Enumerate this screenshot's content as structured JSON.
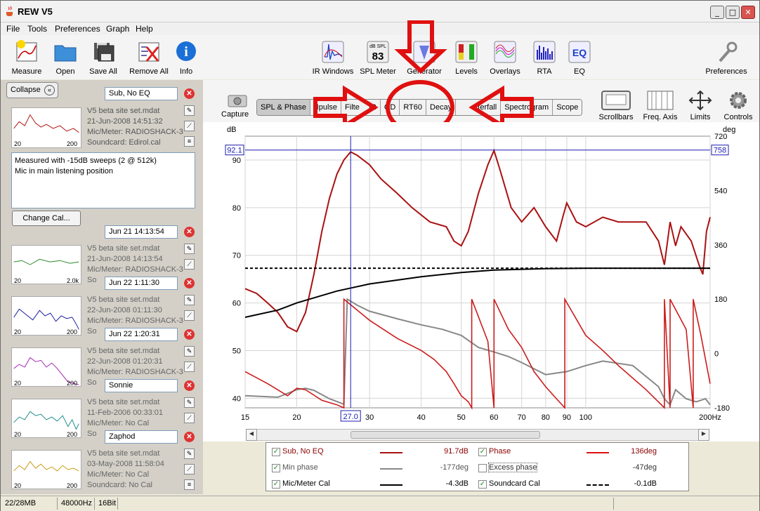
{
  "app": {
    "title": "REW V5"
  },
  "menu": [
    "File",
    "Tools",
    "Preferences",
    "Graph",
    "Help"
  ],
  "toolbar": [
    {
      "label": "Measure",
      "icon": "measure-icon"
    },
    {
      "label": "Open",
      "icon": "folder-icon"
    },
    {
      "label": "Save All",
      "icon": "floppy-icon"
    },
    {
      "label": "Remove All",
      "icon": "remove-all-icon"
    },
    {
      "label": "Info",
      "icon": "info-icon"
    },
    {
      "label": "IR Windows",
      "icon": "ir-windows-icon"
    },
    {
      "label": "SPL Meter",
      "icon": "spl-meter-icon",
      "badge_top": "dB SPL",
      "badge_value": "83"
    },
    {
      "label": "Generator",
      "icon": "generator-icon"
    },
    {
      "label": "Levels",
      "icon": "levels-icon"
    },
    {
      "label": "Overlays",
      "icon": "overlays-icon"
    },
    {
      "label": "RTA",
      "icon": "rta-icon"
    },
    {
      "label": "EQ",
      "icon": "eq-icon"
    },
    {
      "label": "Preferences",
      "icon": "wrench-icon"
    }
  ],
  "left_panel": {
    "collapse_label": "Collapse",
    "change_cal_label": "Change Cal...",
    "notes": [
      "Measured with -15dB sweeps (2 @ 512k)",
      "Mic in main listening position"
    ],
    "measurements": [
      {
        "num": "1",
        "name": "Sub, No EQ",
        "file": "V5 beta site set.mdat",
        "date": "21-Jun-2008 14:51:32",
        "mic": "Mic/Meter: RADIOSHACK-3",
        "card": "Soundcard: Edirol.cal",
        "axis_left": "20",
        "axis_right": "200",
        "color": "#b01010"
      },
      {
        "num": "2",
        "name": "Jun 21 14:13:54",
        "file": "V5 beta site set.mdat",
        "date": "21-Jun-2008 14:13:54",
        "mic": "Mic/Meter: RADIOSHACK-3",
        "card": "So",
        "axis_left": "20",
        "axis_right": "2.0k",
        "color": "#2a8a2a"
      },
      {
        "num": "3",
        "name": "Jun 22 1:11:30",
        "file": "V5 beta site set.mdat",
        "date": "22-Jun-2008 01:11:30",
        "mic": "Mic/Meter: RADIOSHACK-3",
        "card": "So",
        "axis_left": "20",
        "axis_right": "200",
        "color": "#1a1aa0"
      },
      {
        "num": "4",
        "name": "Jun 22 1:20:31",
        "file": "V5 beta site set.mdat",
        "date": "22-Jun-2008 01:20:31",
        "mic": "Mic/Meter: RADIOSHACK-3",
        "card": "So",
        "axis_left": "20",
        "axis_right": "200",
        "color": "#a020b0"
      },
      {
        "num": "5",
        "name": "Sonnie",
        "file": "V5 beta site set.mdat",
        "date": "11-Feb-2006 00:33:01",
        "mic": "Mic/Meter: No Cal",
        "card": "So",
        "axis_left": "20",
        "axis_right": "200",
        "color": "#1a8a8a"
      },
      {
        "num": "6",
        "name": "Zaphod",
        "file": "V5 beta site set.mdat",
        "date": "03-May-2008 11:58:04",
        "mic": "Mic/Meter: No Cal",
        "card": "Soundcard: No Cal",
        "axis_left": "20",
        "axis_right": "200",
        "color": "#c89a10"
      }
    ]
  },
  "graph_tools": {
    "capture": "Capture",
    "tabs": [
      "SPL & Phase",
      "Impulse",
      "Filtered IR",
      "GD",
      "RT60",
      "Decay",
      "Waterfall",
      "Spectrogram",
      "Scope"
    ],
    "tabs_visible": [
      "SPL & Phase",
      "Ipulse",
      "Filte",
      "IR",
      "GD",
      "RT60",
      "Decay",
      "terfall",
      "Spectrogram",
      "Scope"
    ],
    "right_tools": [
      "Scrollbars",
      "Freq. Axis",
      "Limits",
      "Controls"
    ]
  },
  "chart_data": {
    "type": "line",
    "xscale": "log",
    "xlim": [
      15,
      200
    ],
    "ylim_left": [
      38,
      95
    ],
    "ylim_right": [
      -180,
      720
    ],
    "ylabel_left": "dB",
    "ylabel_right": "deg",
    "x_ticks": [
      "15",
      "20",
      "30",
      "40",
      "50",
      "60",
      "70",
      "80",
      "90",
      "100",
      "200Hz"
    ],
    "y_ticks_left": [
      "40",
      "50",
      "60",
      "70",
      "80",
      "90"
    ],
    "y_ticks_right": [
      "-180",
      "0",
      "180",
      "360",
      "540",
      "720"
    ],
    "cursor": {
      "x": "27.0",
      "y_left": "92.1",
      "y_right": "758"
    },
    "grid": true,
    "series": [
      {
        "name": "Sub, No EQ",
        "color": "#aa1111",
        "axis": "left",
        "points": [
          [
            15,
            63
          ],
          [
            16,
            62
          ],
          [
            17,
            60
          ],
          [
            18,
            58
          ],
          [
            19,
            55
          ],
          [
            20,
            54
          ],
          [
            21,
            58
          ],
          [
            22,
            66
          ],
          [
            23,
            75
          ],
          [
            24,
            82
          ],
          [
            25,
            87
          ],
          [
            26,
            90
          ],
          [
            27,
            91.7
          ],
          [
            28,
            91
          ],
          [
            30,
            89
          ],
          [
            32,
            86
          ],
          [
            35,
            83
          ],
          [
            38,
            80
          ],
          [
            42,
            77
          ],
          [
            46,
            76
          ],
          [
            48,
            73
          ],
          [
            50,
            72
          ],
          [
            52,
            75
          ],
          [
            55,
            83
          ],
          [
            58,
            89
          ],
          [
            60,
            92
          ],
          [
            62,
            88
          ],
          [
            66,
            80
          ],
          [
            70,
            77
          ],
          [
            75,
            80
          ],
          [
            80,
            76
          ],
          [
            85,
            73
          ],
          [
            88,
            78
          ],
          [
            90,
            81
          ],
          [
            95,
            77
          ],
          [
            100,
            76
          ],
          [
            110,
            78
          ],
          [
            120,
            77
          ],
          [
            130,
            77
          ],
          [
            140,
            77
          ],
          [
            150,
            73
          ],
          [
            155,
            68
          ],
          [
            160,
            77
          ],
          [
            165,
            72
          ],
          [
            170,
            76
          ],
          [
            180,
            73
          ],
          [
            188,
            68
          ],
          [
            192,
            66
          ],
          [
            196,
            75
          ],
          [
            200,
            78
          ]
        ]
      },
      {
        "name": "Phase",
        "color": "#cc1c1c",
        "axis": "right",
        "points": []
      },
      {
        "name": "Min phase",
        "color": "#888888",
        "axis": "right",
        "points": []
      },
      {
        "name": "Mic/Meter Cal",
        "color": "#000000",
        "axis": "left",
        "points": [
          [
            15,
            57
          ],
          [
            18,
            58.5
          ],
          [
            20,
            60
          ],
          [
            25,
            62.5
          ],
          [
            30,
            64
          ],
          [
            40,
            65.5
          ],
          [
            50,
            66.4
          ],
          [
            60,
            66.9
          ],
          [
            80,
            67.2
          ],
          [
            100,
            67.3
          ],
          [
            200,
            67.3
          ]
        ]
      },
      {
        "name": "Soundcard Cal",
        "color": "#000000",
        "axis": "left",
        "dashed": true,
        "points": [
          [
            15,
            67.3
          ],
          [
            200,
            67.3
          ]
        ]
      }
    ]
  },
  "legend": [
    {
      "label": "Sub, No EQ",
      "checked": true,
      "value": "91.7dB",
      "color": "#aa1111",
      "style": "solid",
      "label_color": "#8b0000"
    },
    {
      "label": "Phase",
      "checked": true,
      "value": "136deg",
      "color": "#dd1111",
      "style": "solid",
      "label_color": "#8b0000"
    },
    {
      "label": "Min phase",
      "checked": true,
      "value": "-177deg",
      "color": "#888888",
      "style": "solid",
      "label_color": "#555555"
    },
    {
      "label": "Excess phase",
      "checked": false,
      "value": "-47deg",
      "color": "#ffffff",
      "style": "none",
      "label_color": "#333333"
    },
    {
      "label": "Mic/Meter Cal",
      "checked": true,
      "value": "-4.3dB",
      "color": "#000000",
      "style": "solid",
      "label_color": "#000000"
    },
    {
      "label": "Soundcard Cal",
      "checked": true,
      "value": "-0.1dB",
      "color": "#000000",
      "style": "dashed",
      "label_color": "#000000"
    }
  ],
  "status": {
    "memory": "22/28MB",
    "rate": "48000Hz",
    "bits": "16Bit"
  }
}
